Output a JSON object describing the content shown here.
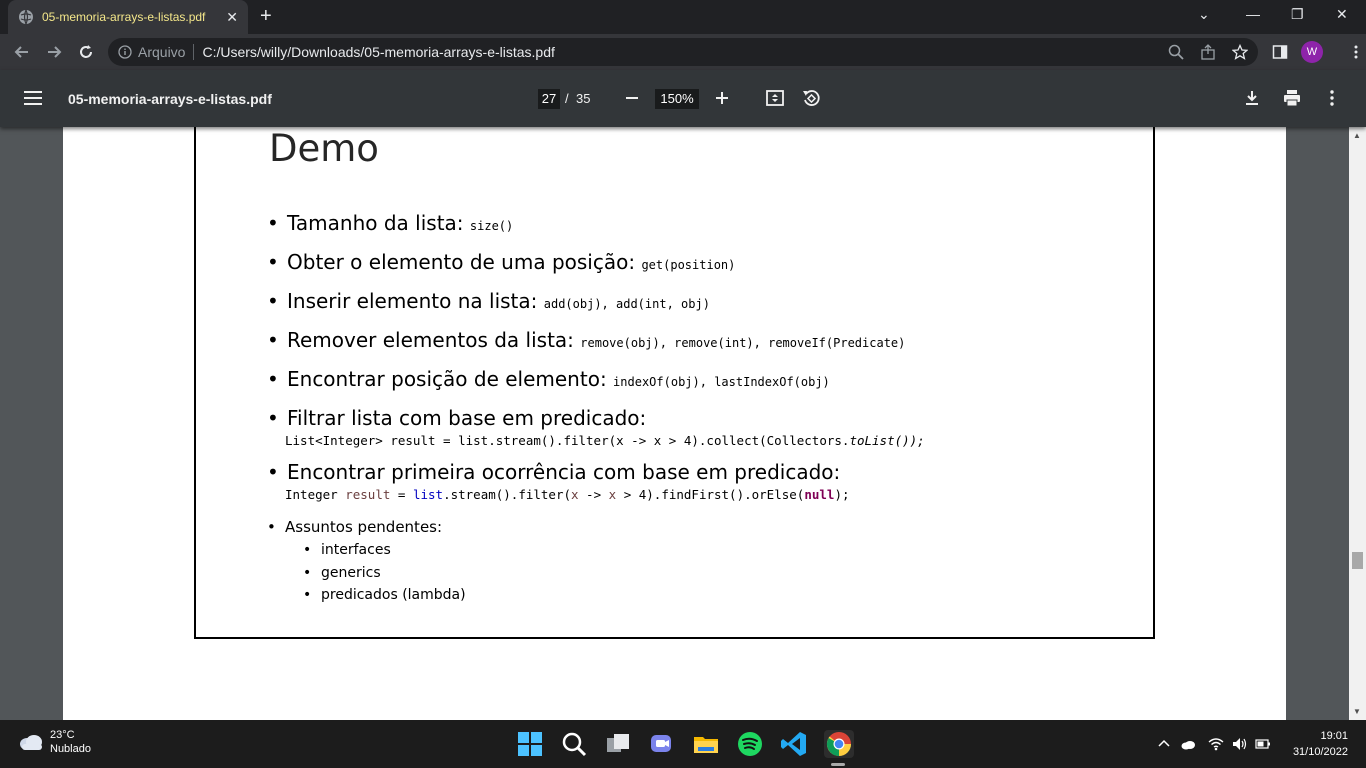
{
  "browser": {
    "tab_title": "05-memoria-arrays-e-listas.pdf",
    "tab_close": "✕",
    "new_tab": "+",
    "omnibox_scheme": "Arquivo",
    "url": "C:/Users/willy/Downloads/05-memoria-arrays-e-listas.pdf",
    "profile_initial": "W",
    "profile_color": "#8e24aa"
  },
  "pdf_toolbar": {
    "filename": "05-memoria-arrays-e-listas.pdf",
    "current_page": "27",
    "page_separator": "/",
    "total_pages": "35",
    "zoom": "150%"
  },
  "slide": {
    "title": "Demo",
    "bullets": [
      {
        "text": "Tamanho da lista: ",
        "code": "size()"
      },
      {
        "text": "Obter o elemento de uma posição: ",
        "code": "get(position)"
      },
      {
        "text": "Inserir elemento na lista: ",
        "code": "add(obj), add(int, obj)"
      },
      {
        "text": "Remover elementos da lista: ",
        "code": "remove(obj), remove(int), removeIf(Predicate)"
      },
      {
        "text": "Encontrar posição de elemento: ",
        "code": "indexOf(obj), lastIndexOf(obj)"
      },
      {
        "text": "Filtrar lista com base em predicado:",
        "code": ""
      },
      {
        "text": "Encontrar primeira ocorrência com base em predicado:",
        "code": ""
      }
    ],
    "filter_code": {
      "part1": "List<Integer> result = list.stream().filter(x -> x > 4).collect(Collectors.",
      "part2": "toList());"
    },
    "findfirst_code": {
      "t1": "Integer ",
      "t2": "result",
      "t3": " = ",
      "t4": "list",
      "t5": ".stream().filter(",
      "t6": "x",
      "t7": " -> ",
      "t8": "x",
      "t9": " > 4).findFirst().orElse(",
      "t10": "null",
      "t11": ");"
    },
    "pending": {
      "heading": "Assuntos pendentes:",
      "items": [
        "interfaces",
        "generics",
        "predicados (lambda)"
      ]
    }
  },
  "taskbar": {
    "temperature": "23°C",
    "condition": "Nublado",
    "time": "19:01",
    "date": "31/10/2022"
  }
}
